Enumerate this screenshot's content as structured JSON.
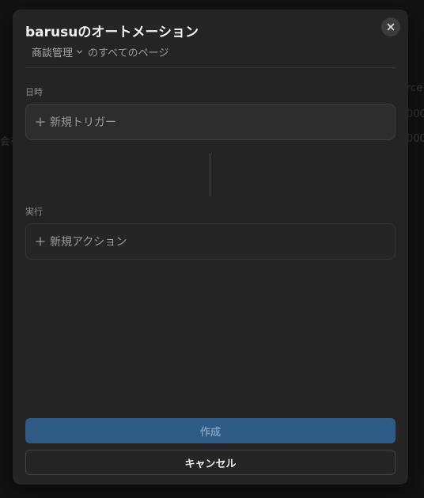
{
  "background": {
    "fragments": [
      "rce",
      "000",
      "000",
      "会社"
    ]
  },
  "modal": {
    "title": "barusuのオートメーション",
    "subtitle": {
      "database": "商談管理",
      "scope": "のすべてのページ"
    },
    "trigger_section": {
      "label": "日時",
      "add_label": "新規トリガー"
    },
    "action_section": {
      "label": "実行",
      "add_label": "新規アクション"
    },
    "create_label": "作成",
    "cancel_label": "キャンセル"
  },
  "colors": {
    "primary_button": "#2e5a86",
    "modal_bg": "#252525"
  },
  "icons": [
    "close-icon",
    "chevron-down-icon",
    "plus-icon"
  ]
}
